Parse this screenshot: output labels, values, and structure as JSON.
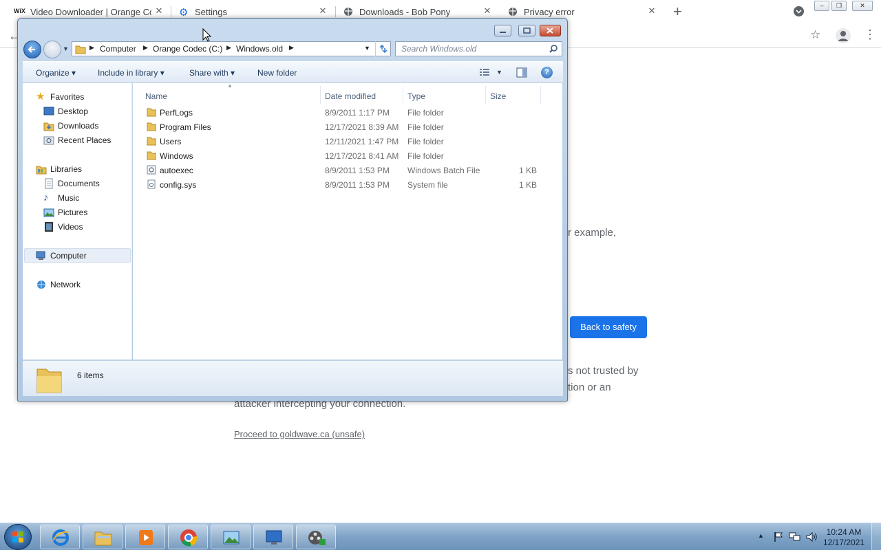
{
  "browser": {
    "tabs": [
      {
        "title": "Video Downloader | Orange Cod",
        "favicon": "wix-icon"
      },
      {
        "title": "Settings",
        "favicon": "gear-icon"
      },
      {
        "title": "Downloads - Bob Pony",
        "favicon": "globe-icon"
      },
      {
        "title": "Privacy error",
        "favicon": "globe-icon"
      }
    ],
    "new_tab": "+"
  },
  "privacy_page": {
    "fragment_example": "r example,",
    "back_to_safety": "Back to safety",
    "fragment_trusted": "s not trusted by",
    "fragment_tion": "tion or an",
    "fragment_attacker": "attacker intercepting your connection.",
    "proceed_link": "Proceed to goldwave.ca (unsafe)"
  },
  "explorer": {
    "breadcrumb": [
      "Computer",
      "Orange Codec (C:)",
      "Windows.old"
    ],
    "search_placeholder": "Search Windows.old",
    "commands": {
      "organize": "Organize",
      "include_in_library": "Include in library",
      "share_with": "Share with",
      "new_folder": "New folder"
    },
    "nav": {
      "favorites": "Favorites",
      "desktop": "Desktop",
      "downloads": "Downloads",
      "recent_places": "Recent Places",
      "libraries": "Libraries",
      "documents": "Documents",
      "music": "Music",
      "pictures": "Pictures",
      "videos": "Videos",
      "computer": "Computer",
      "network": "Network"
    },
    "columns": {
      "name": "Name",
      "date": "Date modified",
      "type": "Type",
      "size": "Size"
    },
    "files": [
      {
        "name": "PerfLogs",
        "date": "8/9/2011 1:17 PM",
        "type": "File folder",
        "size": "",
        "icon": "folder-icon"
      },
      {
        "name": "Program Files",
        "date": "12/17/2021 8:39 AM",
        "type": "File folder",
        "size": "",
        "icon": "folder-icon"
      },
      {
        "name": "Users",
        "date": "12/11/2021 1:47 PM",
        "type": "File folder",
        "size": "",
        "icon": "folder-icon"
      },
      {
        "name": "Windows",
        "date": "12/17/2021 8:41 AM",
        "type": "File folder",
        "size": "",
        "icon": "folder-icon"
      },
      {
        "name": "autoexec",
        "date": "8/9/2011 1:53 PM",
        "type": "Windows Batch File",
        "size": "1 KB",
        "icon": "batch-file-icon"
      },
      {
        "name": "config.sys",
        "date": "8/9/2011 1:53 PM",
        "type": "System file",
        "size": "1 KB",
        "icon": "system-file-icon"
      }
    ],
    "status": "6 items"
  },
  "taskbar": {
    "time": "10:24 AM",
    "date": "12/17/2021"
  },
  "colors": {
    "chrome_blue": "#1a73e8",
    "aero_frame": "#b7cde5",
    "taskbar": "#7fa3c6"
  }
}
